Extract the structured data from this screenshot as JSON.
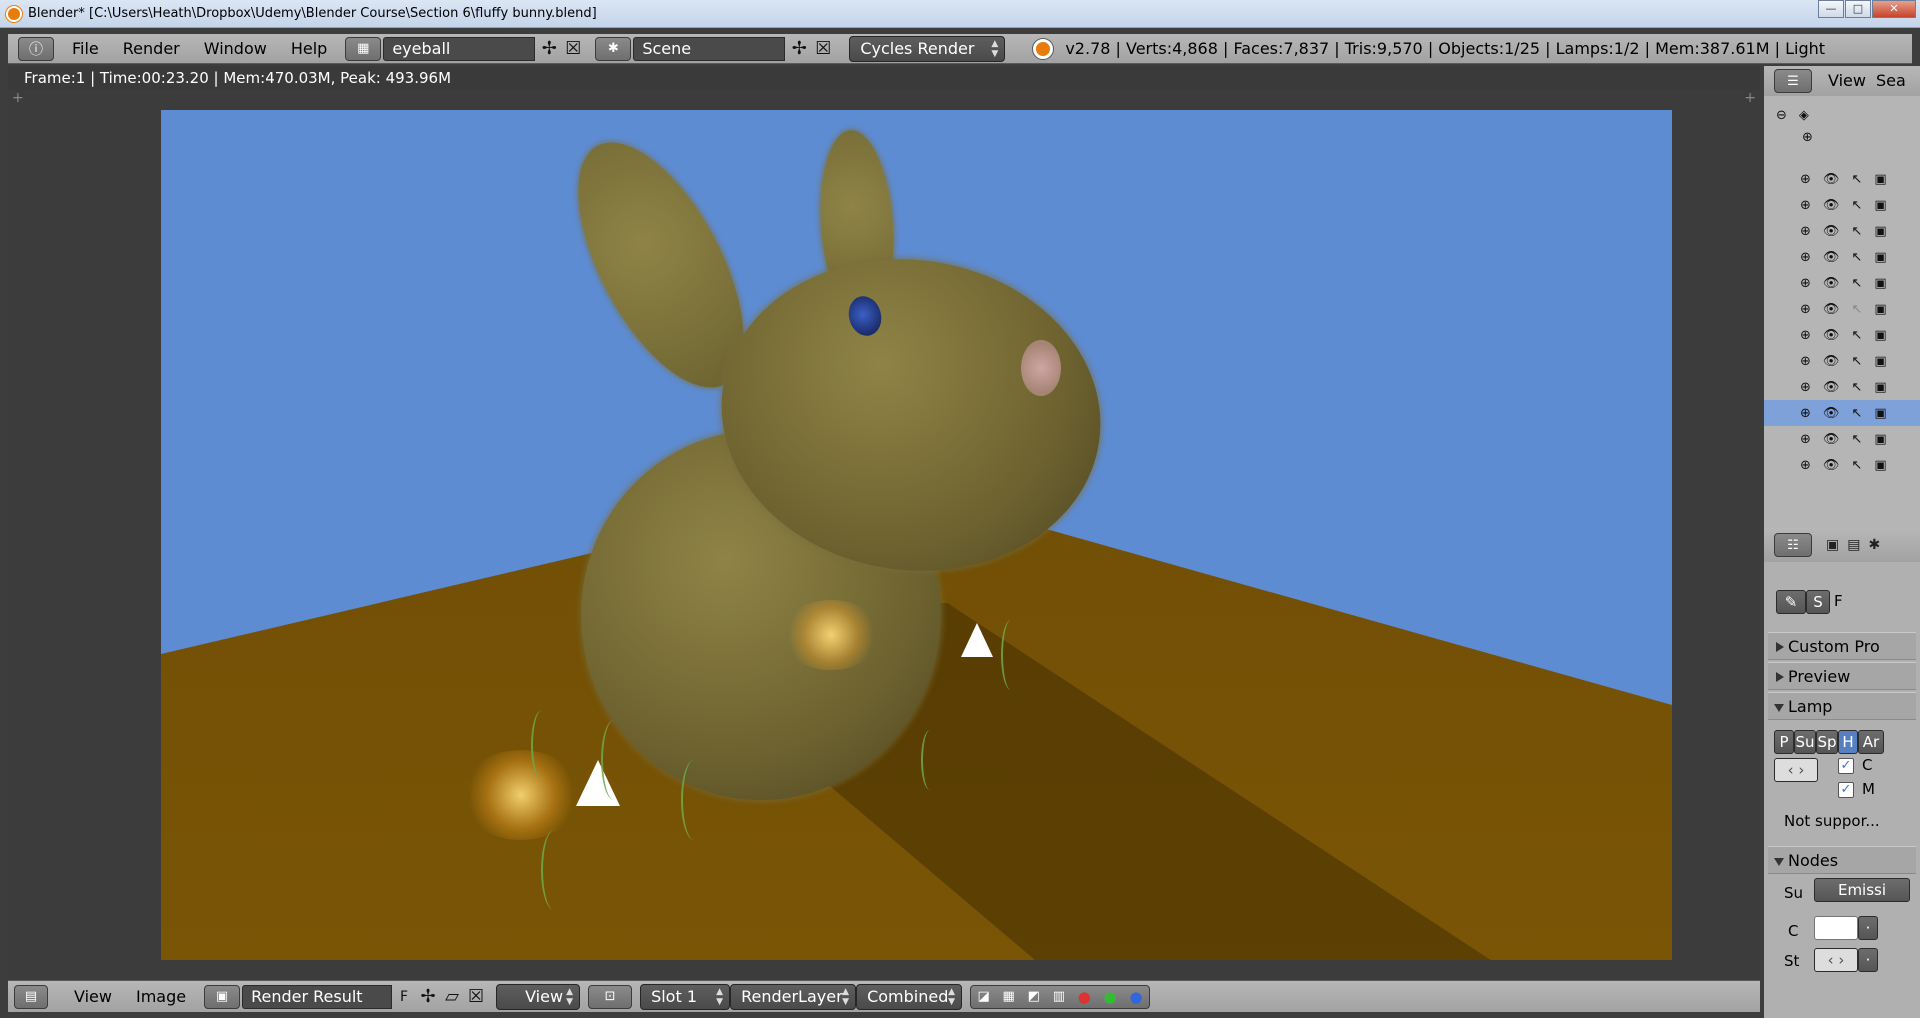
{
  "titlebar": {
    "title": "Blender* [C:\\Users\\Heath\\Dropbox\\Udemy\\Blender Course\\Section 6\\fluffy bunny.blend]"
  },
  "menu": {
    "file": "File",
    "render": "Render",
    "window": "Window",
    "help": "Help"
  },
  "screen_layout": {
    "value": "eyeball"
  },
  "scene": {
    "value": "Scene"
  },
  "render_engine": {
    "value": "Cycles Render"
  },
  "stats": {
    "text": "v2.78 | Verts:4,868 | Faces:7,837 | Tris:9,570 | Objects:1/25 | Lamps:1/2 | Mem:387.61M | Light"
  },
  "render_info": {
    "text": "Frame:1 | Time:00:23.20 | Mem:470.03M, Peak: 493.96M"
  },
  "bottombar": {
    "view": "View",
    "image": "Image",
    "image_name": "Render Result",
    "fake_user": "F",
    "view_mode": "View",
    "slot": "Slot 1",
    "layer": "RenderLayer",
    "pass": "Combined"
  },
  "outliner": {
    "view": "View",
    "search": "Sea"
  },
  "properties": {
    "tab_s": "S",
    "tab_f": "F",
    "custom_props": "Custom Pro",
    "preview": "Preview",
    "lamp": "Lamp",
    "lamp_types": [
      "P",
      "Su",
      "Sp",
      "H",
      "Ar"
    ],
    "check_c": "C",
    "check_m": "M",
    "not_supported": "Not suppor...",
    "nodes": "Nodes",
    "surface_label": "Su",
    "surface_value": "Emissi",
    "color_label": "C",
    "strength_label": "St"
  },
  "colors": {
    "selected_row": "#7ea1d9",
    "render_bg": "#5e8cd3",
    "floor": "#6a4a05",
    "highlight_btn": "#5680c2"
  }
}
